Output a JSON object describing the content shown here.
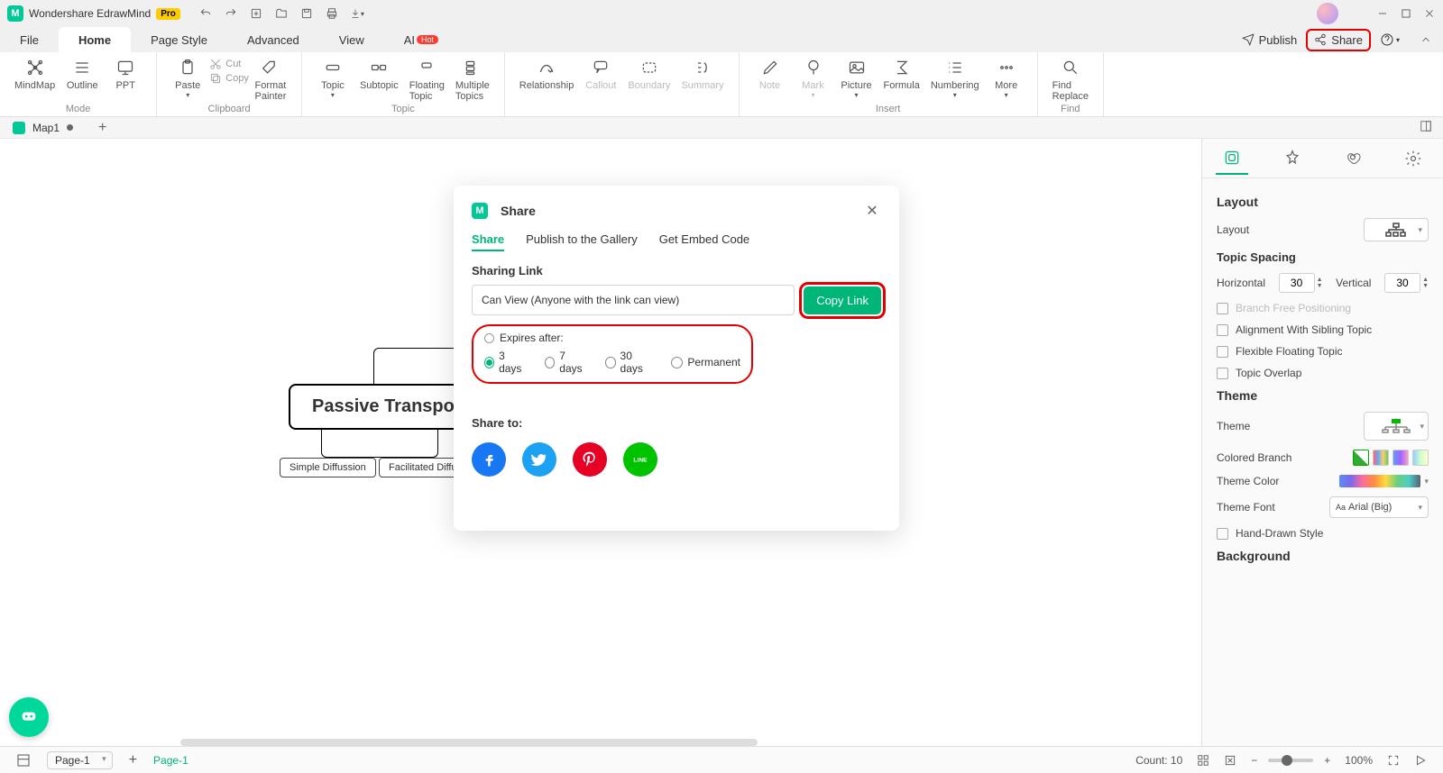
{
  "app": {
    "name": "Wondershare EdrawMind",
    "badge": "Pro"
  },
  "menu": {
    "file": "File",
    "home": "Home",
    "pageStyle": "Page Style",
    "advanced": "Advanced",
    "view": "View",
    "ai": "AI",
    "aiBadge": "Hot"
  },
  "topRight": {
    "publish": "Publish",
    "share": "Share"
  },
  "ribbon": {
    "mode": {
      "label": "Mode",
      "mindmap": "MindMap",
      "outline": "Outline",
      "ppt": "PPT"
    },
    "clipboard": {
      "label": "Clipboard",
      "paste": "Paste",
      "cut": "Cut",
      "copy": "Copy",
      "format": "Format\nPainter"
    },
    "topic": {
      "label": "Topic",
      "topic": "Topic",
      "subtopic": "Subtopic",
      "floating": "Floating\nTopic",
      "multiple": "Multiple\nTopics"
    },
    "relationship": "Relationship",
    "callout": "Callout",
    "boundary": "Boundary",
    "summary": "Summary",
    "insert": {
      "label": "Insert",
      "note": "Note",
      "mark": "Mark",
      "picture": "Picture",
      "formula": "Formula",
      "numbering": "Numbering",
      "more": "More"
    },
    "find": {
      "label": "Find",
      "findReplace": "Find\nReplace"
    }
  },
  "docTabs": {
    "map1": "Map1"
  },
  "mindmap": {
    "main": "Passive Transport",
    "sub1": "Simple Diffussion",
    "sub2": "Facilitated Diffusic"
  },
  "shareModal": {
    "title": "Share",
    "tabs": {
      "share": "Share",
      "publish": "Publish to the Gallery",
      "embed": "Get Embed Code"
    },
    "sharingLink": "Sharing Link",
    "permission": "Can View (Anyone with the link can view)",
    "copyLink": "Copy Link",
    "expiresLabel": "Expires after:",
    "opt3": "3 days",
    "opt7": "7 days",
    "opt30": "30 days",
    "optPerm": "Permanent",
    "shareTo": "Share to:"
  },
  "sidebar": {
    "layout": "Layout",
    "layoutLabel": "Layout",
    "topicSpacing": "Topic Spacing",
    "horizontal": "Horizontal",
    "hVal": "30",
    "vertical": "Vertical",
    "vVal": "30",
    "branchFree": "Branch Free Positioning",
    "alignment": "Alignment With Sibling Topic",
    "flexFloat": "Flexible Floating Topic",
    "overlap": "Topic Overlap",
    "theme": "Theme",
    "themeLabel": "Theme",
    "coloredBranch": "Colored Branch",
    "themeColor": "Theme Color",
    "themeFont": "Theme Font",
    "fontVal": "Arial (Big)",
    "handDrawn": "Hand-Drawn Style",
    "background": "Background"
  },
  "status": {
    "pageSel": "Page-1",
    "pageTab": "Page-1",
    "count": "Count: 10",
    "minus": "−",
    "plus": "+",
    "zoom": "100%"
  }
}
